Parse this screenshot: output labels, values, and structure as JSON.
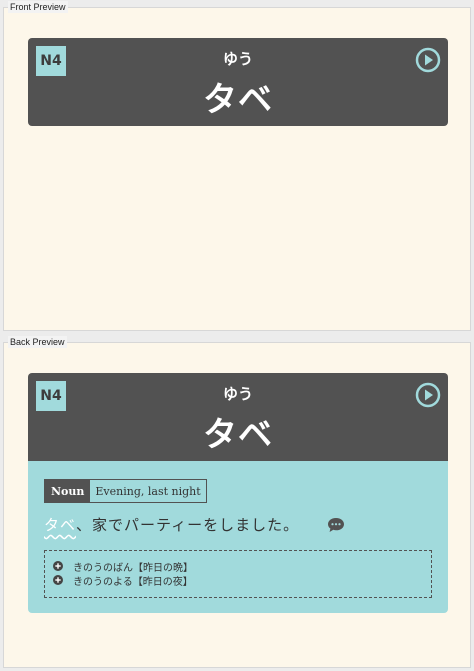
{
  "front": {
    "label": "Front Preview",
    "card": {
      "level": "N4",
      "reading": "ゆう",
      "word": "タベ"
    }
  },
  "back": {
    "label": "Back Preview",
    "card": {
      "level": "N4",
      "reading": "ゆう",
      "word": "タベ",
      "part_of_speech": "Noun",
      "meaning": "Evening, last night",
      "sentence": {
        "highlight": "タベ",
        "rest": "、家でパーティーをしました。"
      },
      "examples": [
        "きのうのばん【昨日の晩】",
        "きのうのよる【昨日の夜】"
      ]
    }
  },
  "icons": {
    "play": "play-circle-icon",
    "chat": "speech-bubble-icon",
    "plus": "plus-circle-icon"
  },
  "colors": {
    "header_bg": "#525252",
    "accent": "#a1dadc",
    "page_bg": "#fdf7ea"
  }
}
